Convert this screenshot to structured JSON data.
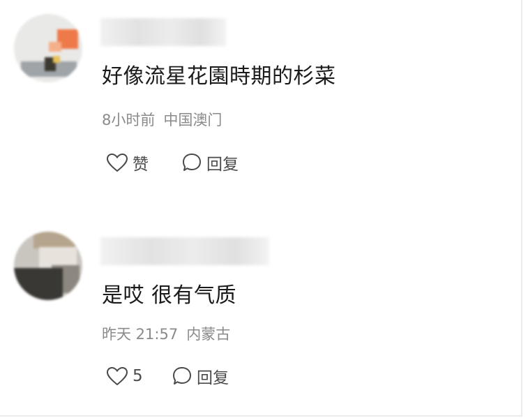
{
  "comments": [
    {
      "text": "好像流星花園時期的杉菜",
      "time": "8小时前",
      "location": "中国澳门",
      "like_label": "赞",
      "reply_label": "回复"
    },
    {
      "text": "是哎  很有气质",
      "time": "昨天 21:57",
      "location": "内蒙古",
      "like_label": "5",
      "reply_label": "回复"
    }
  ],
  "icons": {
    "like": "heart-outline-icon",
    "reply": "speech-bubble-icon"
  },
  "colors": {
    "text": "#1a1a1a",
    "meta": "#8a8a8a",
    "action": "#4a4a4a"
  }
}
